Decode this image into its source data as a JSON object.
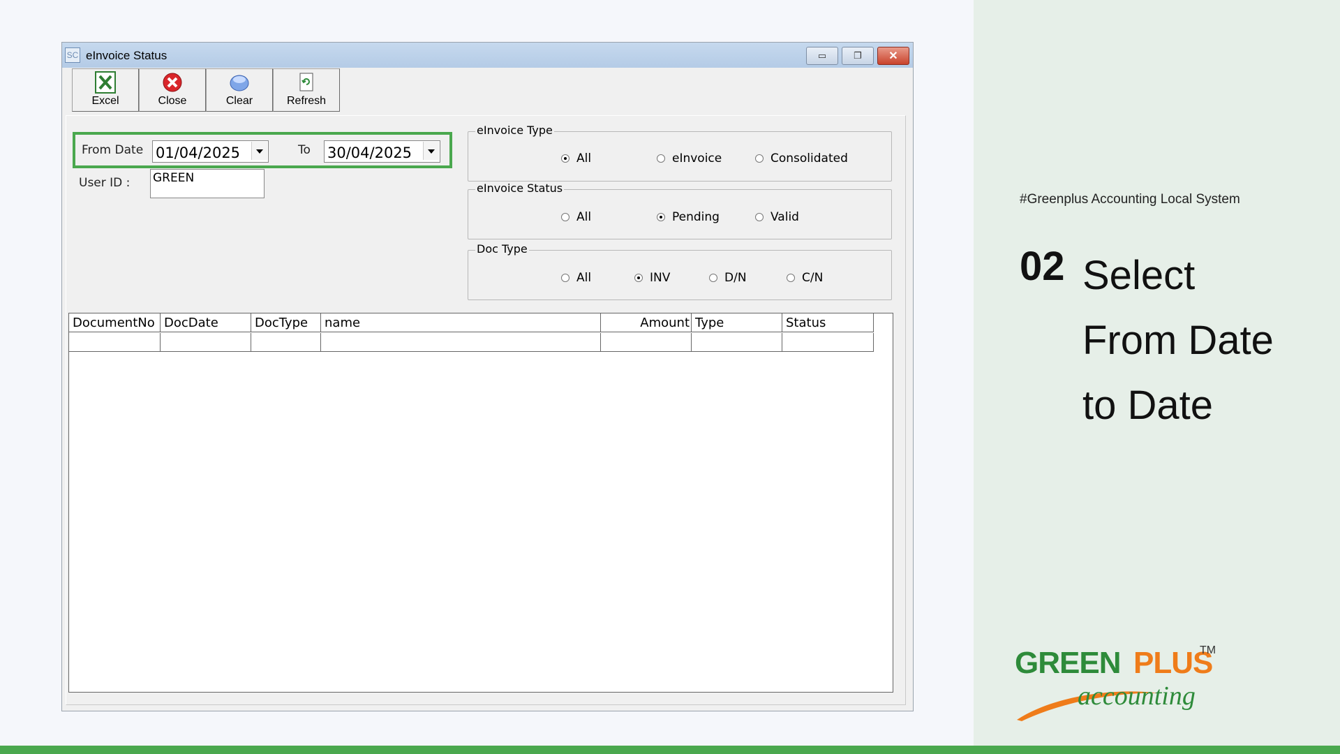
{
  "slide": {
    "hashtag": "#Greenplus Accounting Local System",
    "step_number": "02",
    "step_title_line1": "Select",
    "step_title_line2": "From Date",
    "step_title_line3": "to Date",
    "logo": {
      "green": "GREEN",
      "orange": "PLUS",
      "tm": "TM",
      "sub": "accounting"
    },
    "colors": {
      "brand_green": "#4aa84e",
      "brand_orange": "#ef7c1a",
      "panel_bg": "#e6efe8"
    }
  },
  "window": {
    "icon_text": "SC",
    "title": "eInvoice Status",
    "controls": {
      "minimize": "▭",
      "maximize": "❐",
      "close": "✕"
    }
  },
  "toolbar": {
    "excel_label": "Excel",
    "close_label": "Close",
    "clear_label": "Clear",
    "refresh_label": "Refresh"
  },
  "filters": {
    "from_date_label": "From Date",
    "from_date_value": "01/04/2025",
    "to_label": "To",
    "to_date_value": "30/04/2025",
    "user_id_label": "User ID :",
    "user_id_value": "GREEN"
  },
  "einvoice_type": {
    "legend": "eInvoice Type",
    "options": [
      "All",
      "eInvoice",
      "Consolidated"
    ],
    "selected": "All"
  },
  "einvoice_status": {
    "legend": "eInvoice Status",
    "options": [
      "All",
      "Pending",
      "Valid"
    ],
    "selected": "Pending"
  },
  "doc_type": {
    "legend": "Doc Type",
    "options": [
      "All",
      "INV",
      "D/N",
      "C/N"
    ],
    "selected": "INV"
  },
  "grid": {
    "columns": [
      "DocumentNo",
      "DocDate",
      "DocType",
      "name",
      "Amount",
      "Type",
      "Status"
    ]
  }
}
